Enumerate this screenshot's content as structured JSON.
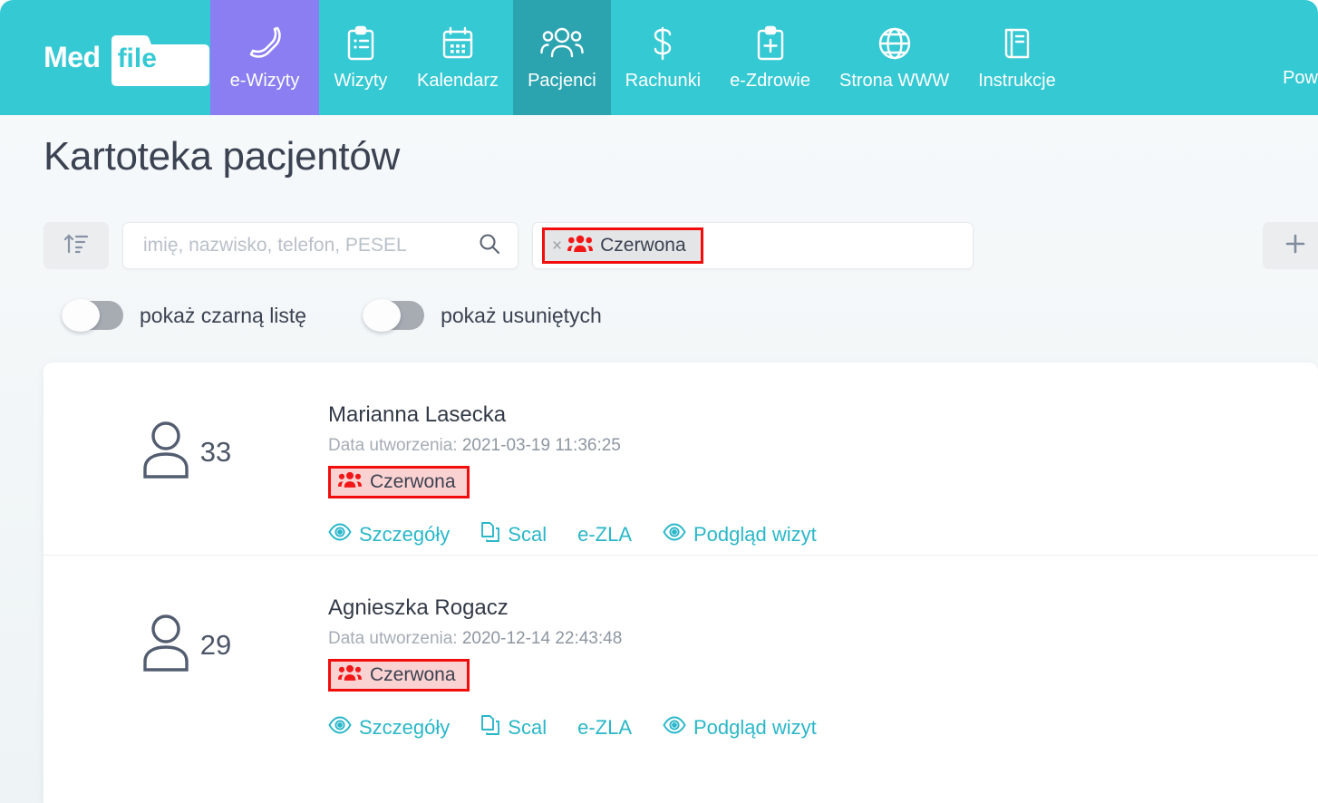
{
  "brand": {
    "name_1": "Med",
    "name_2": "file"
  },
  "nav": {
    "items": [
      {
        "label": "e-Wizyty",
        "icon": "phone-icon",
        "state": "highlight"
      },
      {
        "label": "Wizyty",
        "icon": "clipboard-list-icon",
        "state": "normal"
      },
      {
        "label": "Kalendarz",
        "icon": "calendar-icon",
        "state": "normal"
      },
      {
        "label": "Pacjenci",
        "icon": "users-icon",
        "state": "active"
      },
      {
        "label": "Rachunki",
        "icon": "dollar-icon",
        "state": "normal"
      },
      {
        "label": "e-Zdrowie",
        "icon": "clipboard-medical-icon",
        "state": "normal"
      },
      {
        "label": "Strona WWW",
        "icon": "globe-icon",
        "state": "normal"
      },
      {
        "label": "Instrukcje",
        "icon": "book-icon",
        "state": "normal"
      },
      {
        "label": "Pow",
        "icon": "none",
        "state": "cutoff"
      }
    ]
  },
  "page": {
    "title": "Kartoteka pacjentów"
  },
  "filters": {
    "sort_icon": "sort-ascending-icon",
    "search_placeholder": "imię, nazwisko, telefon, PESEL",
    "search_value": "",
    "search_icon": "search-icon",
    "tag_chip": {
      "label": "Czerwona",
      "remove": "×",
      "icon": "group-icon"
    },
    "add_button_label": "+"
  },
  "toggles": [
    {
      "label": "pokaż czarną listę",
      "on": false
    },
    {
      "label": "pokaż usuniętych",
      "on": false
    }
  ],
  "patients": [
    {
      "age": "33",
      "name": "Marianna Lasecka",
      "created_label": "Data utworzenia:",
      "created_value": "2021-03-19 11:36:25",
      "group": "Czerwona",
      "actions": [
        {
          "label": "Szczegóły",
          "icon": "eye-icon"
        },
        {
          "label": "Scal",
          "icon": "copy-icon"
        },
        {
          "label": "e-ZLA",
          "icon": "none"
        },
        {
          "label": "Podgląd wizyt",
          "icon": "eye-icon"
        }
      ]
    },
    {
      "age": "29",
      "name": "Agnieszka Rogacz",
      "created_label": "Data utworzenia:",
      "created_value": "2020-12-14 22:43:48",
      "group": "Czerwona",
      "actions": [
        {
          "label": "Szczegóły",
          "icon": "eye-icon"
        },
        {
          "label": "Scal",
          "icon": "copy-icon"
        },
        {
          "label": "e-ZLA",
          "icon": "none"
        },
        {
          "label": "Podgląd wizyt",
          "icon": "eye-icon"
        }
      ]
    }
  ],
  "colors": {
    "brand_teal": "#35c9d4",
    "active_tab": "#2ba4b0",
    "ewizyty_purple": "#8a7ef2",
    "annotation_red": "#f20d0d",
    "tag_red": "#ef2222",
    "tag_bg": "#fbd2d2",
    "link_teal": "#2ab7c9",
    "text_dark": "#3b4251",
    "text_muted": "#a5acb6"
  }
}
